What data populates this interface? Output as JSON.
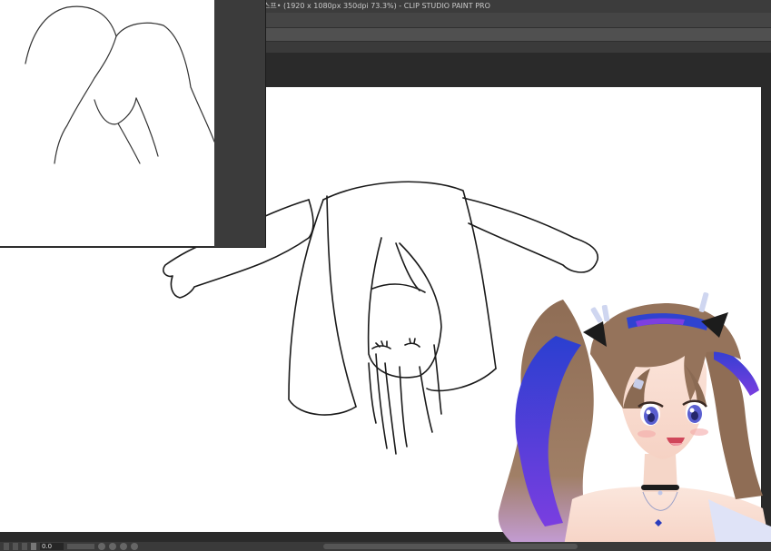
{
  "window": {
    "title": "스프• (1920 x 1080px 350dpi 73.3%)  - CLIP STUDIO PAINT PRO"
  },
  "statusbar": {
    "zoom_value": "0.0"
  },
  "icons": {
    "canvas_sketch": "sketch-drawing",
    "navigator_sketch": "navigator-thumbnail",
    "avatar": "vtuber-avatar"
  },
  "colors": {
    "chrome_dark": "#2b2b2b",
    "canvas": "#ffffff",
    "hair_brown": "#8b6a52",
    "hair_blue": "#2f4fd8",
    "hair_purple": "#8a3fe0"
  }
}
